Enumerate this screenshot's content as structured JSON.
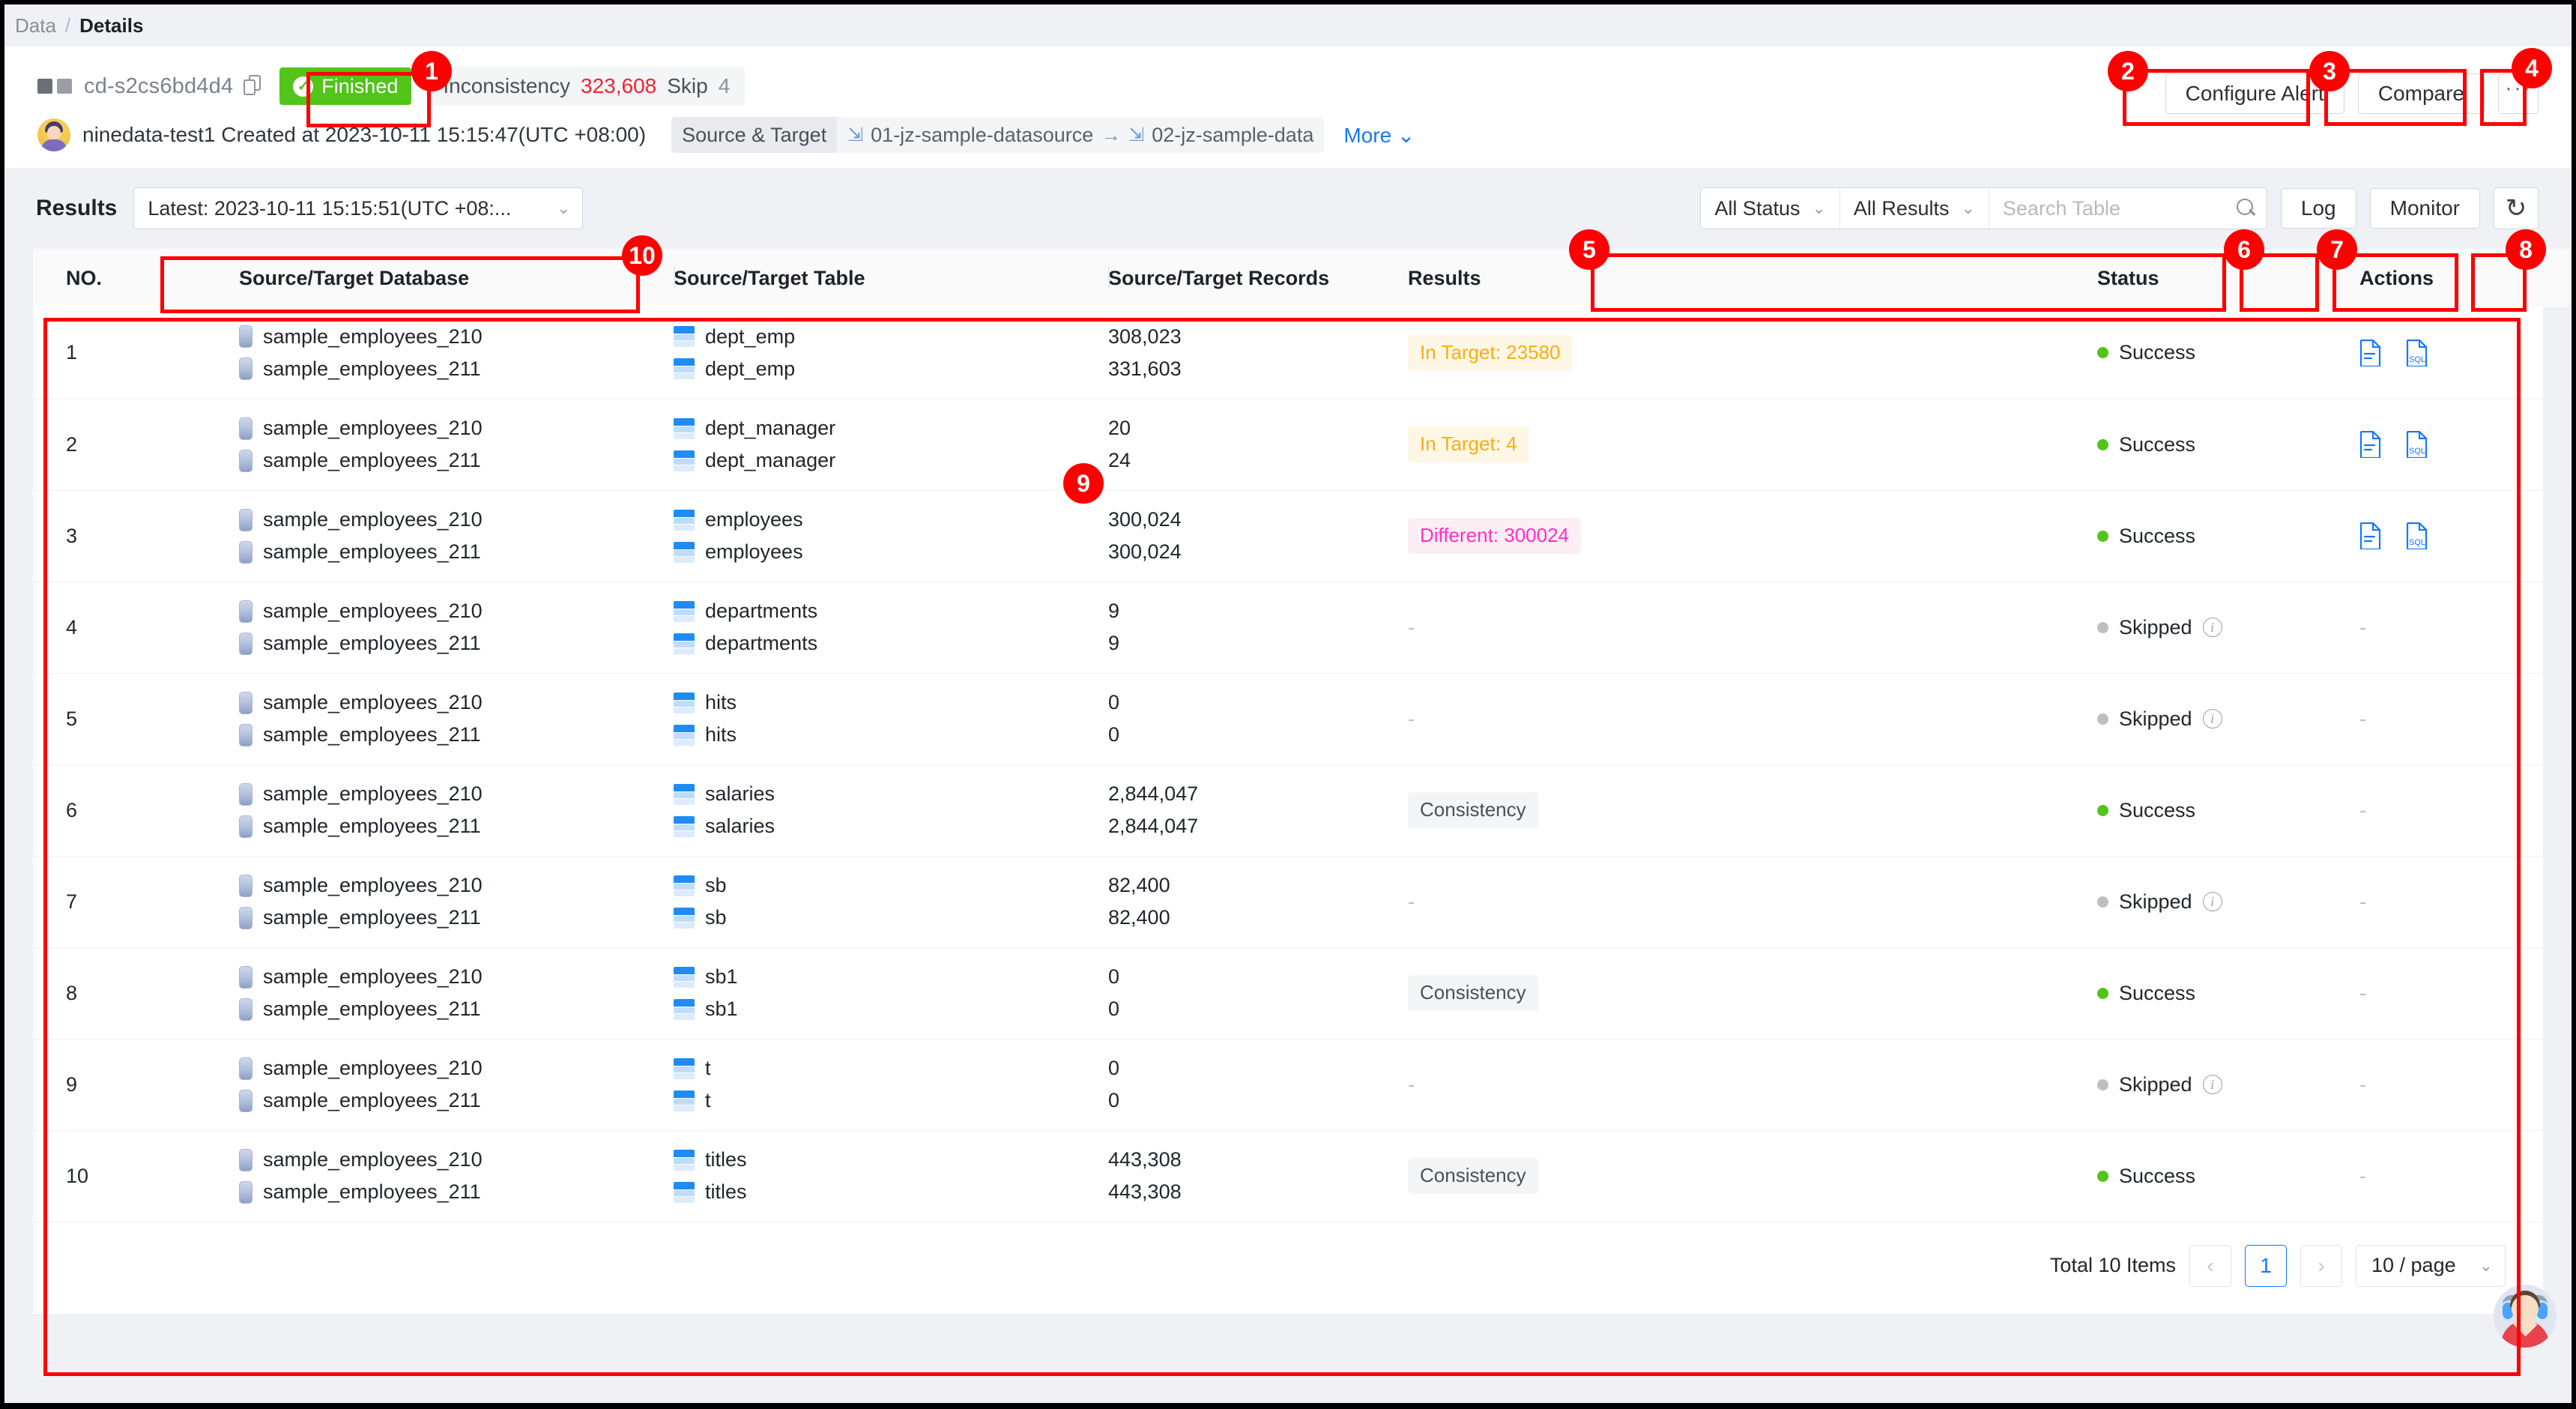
{
  "breadcrumb": {
    "root": "Data",
    "sep": "/",
    "current": "Details"
  },
  "header": {
    "job_id": "cd-s2cs6bd4d4",
    "status_badge": "Finished",
    "inconsistency_label": "Inconsistency",
    "inconsistency_value": "323,608",
    "skip_label": "Skip",
    "skip_value": "4",
    "configure_alert": "Configure Alert",
    "compare": "Compare",
    "more_actions": "···",
    "user_line": "ninedata-test1 Created at 2023-10-11 15:15:47(UTC +08:00)",
    "source_target_label": "Source & Target",
    "source_name": "01-jz-sample-datasource",
    "target_name": "02-jz-sample-data",
    "arrow": "→",
    "more_link": "More"
  },
  "toolbar": {
    "results_title": "Results",
    "latest_select": "Latest: 2023-10-11 15:15:51(UTC +08:...",
    "all_status": "All Status",
    "all_results": "All Results",
    "search_placeholder": "Search Table",
    "log": "Log",
    "monitor": "Monitor"
  },
  "table": {
    "columns": [
      "NO.",
      "Source/Target Database",
      "Source/Target Table",
      "Source/Target Records",
      "Results",
      "Status",
      "Actions"
    ],
    "rows": [
      {
        "no": "1",
        "src_db": "sample_employees_210",
        "tgt_db": "sample_employees_211",
        "src_tbl": "dept_emp",
        "tgt_tbl": "dept_emp",
        "src_rec": "308,023",
        "tgt_rec": "331,603",
        "result": "In Target: 23580",
        "result_kind": "target",
        "status": "Success",
        "status_kind": "success",
        "actions": "icons"
      },
      {
        "no": "2",
        "src_db": "sample_employees_210",
        "tgt_db": "sample_employees_211",
        "src_tbl": "dept_manager",
        "tgt_tbl": "dept_manager",
        "src_rec": "20",
        "tgt_rec": "24",
        "result": "In Target: 4",
        "result_kind": "target",
        "status": "Success",
        "status_kind": "success",
        "actions": "icons"
      },
      {
        "no": "3",
        "src_db": "sample_employees_210",
        "tgt_db": "sample_employees_211",
        "src_tbl": "employees",
        "tgt_tbl": "employees",
        "src_rec": "300,024",
        "tgt_rec": "300,024",
        "result": "Different: 300024",
        "result_kind": "diff",
        "status": "Success",
        "status_kind": "success",
        "actions": "icons"
      },
      {
        "no": "4",
        "src_db": "sample_employees_210",
        "tgt_db": "sample_employees_211",
        "src_tbl": "departments",
        "tgt_tbl": "departments",
        "src_rec": "9",
        "tgt_rec": "9",
        "result": "-",
        "result_kind": "dash",
        "status": "Skipped",
        "status_kind": "skipped",
        "actions": "dash"
      },
      {
        "no": "5",
        "src_db": "sample_employees_210",
        "tgt_db": "sample_employees_211",
        "src_tbl": "hits",
        "tgt_tbl": "hits",
        "src_rec": "0",
        "tgt_rec": "0",
        "result": "-",
        "result_kind": "dash",
        "status": "Skipped",
        "status_kind": "skipped",
        "actions": "dash"
      },
      {
        "no": "6",
        "src_db": "sample_employees_210",
        "tgt_db": "sample_employees_211",
        "src_tbl": "salaries",
        "tgt_tbl": "salaries",
        "src_rec": "2,844,047",
        "tgt_rec": "2,844,047",
        "result": "Consistency",
        "result_kind": "cons",
        "status": "Success",
        "status_kind": "success",
        "actions": "dash"
      },
      {
        "no": "7",
        "src_db": "sample_employees_210",
        "tgt_db": "sample_employees_211",
        "src_tbl": "sb",
        "tgt_tbl": "sb",
        "src_rec": "82,400",
        "tgt_rec": "82,400",
        "result": "-",
        "result_kind": "dash",
        "status": "Skipped",
        "status_kind": "skipped",
        "actions": "dash"
      },
      {
        "no": "8",
        "src_db": "sample_employees_210",
        "tgt_db": "sample_employees_211",
        "src_tbl": "sb1",
        "tgt_tbl": "sb1",
        "src_rec": "0",
        "tgt_rec": "0",
        "result": "Consistency",
        "result_kind": "cons",
        "status": "Success",
        "status_kind": "success",
        "actions": "dash"
      },
      {
        "no": "9",
        "src_db": "sample_employees_210",
        "tgt_db": "sample_employees_211",
        "src_tbl": "t",
        "tgt_tbl": "t",
        "src_rec": "0",
        "tgt_rec": "0",
        "result": "-",
        "result_kind": "dash",
        "status": "Skipped",
        "status_kind": "skipped",
        "actions": "dash"
      },
      {
        "no": "10",
        "src_db": "sample_employees_210",
        "tgt_db": "sample_employees_211",
        "src_tbl": "titles",
        "tgt_tbl": "titles",
        "src_rec": "443,308",
        "tgt_rec": "443,308",
        "result": "Consistency",
        "result_kind": "cons",
        "status": "Success",
        "status_kind": "success",
        "actions": "dash"
      }
    ]
  },
  "pagination": {
    "total": "Total 10 Items",
    "prev": "‹",
    "current_page": "1",
    "next": "›",
    "page_size": "10 / page"
  },
  "annotations": [
    {
      "n": "1"
    },
    {
      "n": "2"
    },
    {
      "n": "3"
    },
    {
      "n": "4"
    },
    {
      "n": "5"
    },
    {
      "n": "6"
    },
    {
      "n": "7"
    },
    {
      "n": "8"
    },
    {
      "n": "9"
    },
    {
      "n": "10"
    }
  ],
  "colors": {
    "accent": "#1677ff",
    "success": "#52c41a",
    "danger": "#f5222d",
    "warning": "#faad14",
    "diff": "#ff30c0",
    "annotation": "#ff0000"
  }
}
